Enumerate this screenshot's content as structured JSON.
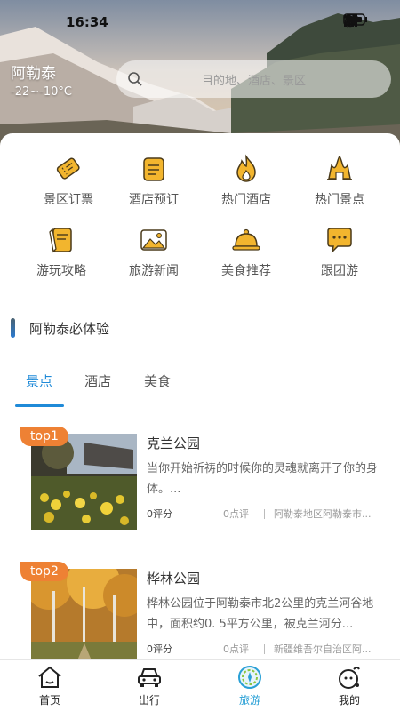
{
  "status_bar": {
    "time": "16:34"
  },
  "header": {
    "city": "阿勒泰",
    "temperature": "-22~-10°C",
    "search_placeholder": "目的地、酒店、景区"
  },
  "categories": [
    {
      "label": "景区订票",
      "icon": "ticket-icon"
    },
    {
      "label": "酒店预订",
      "icon": "hotel-booking-icon"
    },
    {
      "label": "热门酒店",
      "icon": "flame-icon"
    },
    {
      "label": "热门景点",
      "icon": "landmark-icon"
    },
    {
      "label": "游玩攻略",
      "icon": "guide-notes-icon"
    },
    {
      "label": "旅游新闻",
      "icon": "news-photo-icon"
    },
    {
      "label": "美食推荐",
      "icon": "food-cloche-icon"
    },
    {
      "label": "跟团游",
      "icon": "group-chat-icon"
    }
  ],
  "section": {
    "title": "阿勒泰必体验"
  },
  "tabs": [
    {
      "label": "景点",
      "active": true
    },
    {
      "label": "酒店",
      "active": false
    },
    {
      "label": "美食",
      "active": false
    }
  ],
  "items": [
    {
      "badge": "top1",
      "name": "克兰公园",
      "desc": "当你开始祈祷的时候你的灵魂就离开了你的身体。...",
      "score": "0评分",
      "reviews": "0点评",
      "location": "阿勒泰地区阿勒泰市..."
    },
    {
      "badge": "top2",
      "name": "桦林公园",
      "desc": "桦林公园位于阿勒泰市北2公里的克兰河谷地中，面积约0. 5平方公里，被克兰河分...",
      "score": "0评分",
      "reviews": "0点评",
      "location": "新疆维吾尔自治区阿..."
    }
  ],
  "bottom_nav": [
    {
      "label": "首页",
      "icon": "home-icon",
      "active": false
    },
    {
      "label": "出行",
      "icon": "car-icon",
      "active": false
    },
    {
      "label": "旅游",
      "icon": "compass-icon",
      "active": true
    },
    {
      "label": "我的",
      "icon": "profile-icon",
      "active": false
    }
  ],
  "colors": {
    "accent": "#1f8ad8",
    "badge": "#ee8134",
    "icon_yellow": "#f2b52e"
  }
}
